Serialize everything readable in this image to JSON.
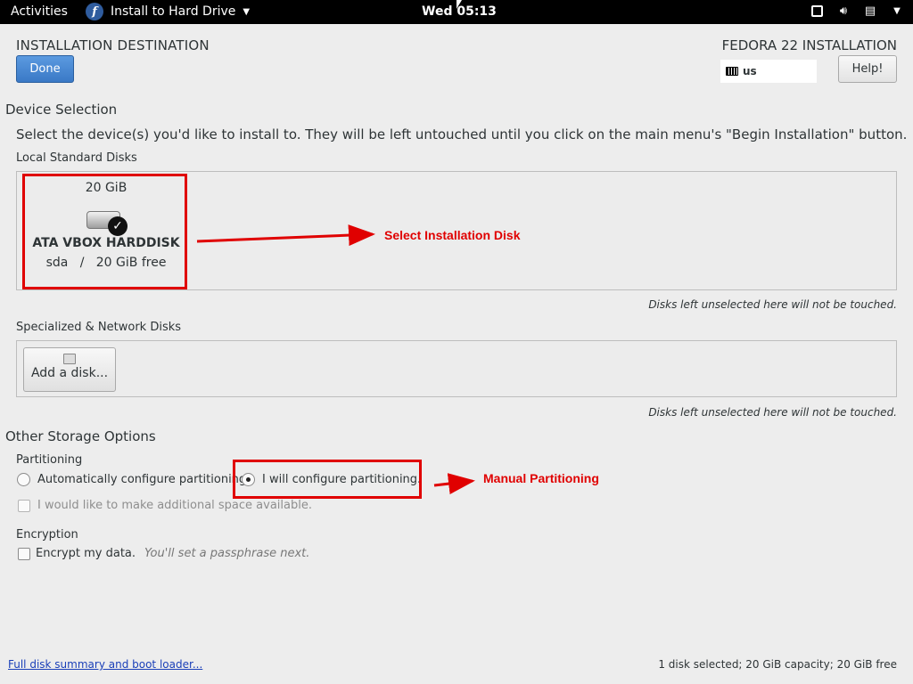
{
  "topbar": {
    "activities": "Activities",
    "app_name": "Install to Hard Drive",
    "app_icon": "f",
    "clock": "Wed 05:13"
  },
  "header": {
    "title": "INSTALLATION DESTINATION",
    "done_label": "Done",
    "product": "FEDORA 22 INSTALLATION",
    "keyboard_layout": "us",
    "help_label": "Help!"
  },
  "device_selection": {
    "heading": "Device Selection",
    "description": "Select the device(s) you'd like to install to.  They will be left untouched until you click on the main menu's \"Begin Installation\" button.",
    "local_heading": "Local Standard Disks",
    "disks": [
      {
        "size": "20 GiB",
        "name": "ATA VBOX HARDDISK",
        "device": "sda",
        "separator": "/",
        "free": "20 GiB free",
        "selected": true
      }
    ],
    "local_note": "Disks left unselected here will not be touched.",
    "specialized_heading": "Specialized & Network Disks",
    "add_disk_label": "Add a disk...",
    "specialized_note": "Disks left unselected here will not be touched."
  },
  "storage_options": {
    "heading": "Other Storage Options",
    "partitioning_heading": "Partitioning",
    "auto_label": "Automatically configure partitioning.",
    "manual_label": "I will configure partitioning.",
    "selected": "manual",
    "space_label": "I would like to make additional space available.",
    "encryption_heading": "Encryption",
    "encrypt_label": "Encrypt my data.",
    "encrypt_hint": "You'll set a passphrase next."
  },
  "footer": {
    "summary_link": "Full disk summary and boot loader...",
    "summary": "1 disk selected; 20 GiB capacity; 20 GiB free"
  },
  "annotations": {
    "disk_label": "Select Installation Disk",
    "partition_label": "Manual Partitioning",
    "color": "#e00000"
  }
}
